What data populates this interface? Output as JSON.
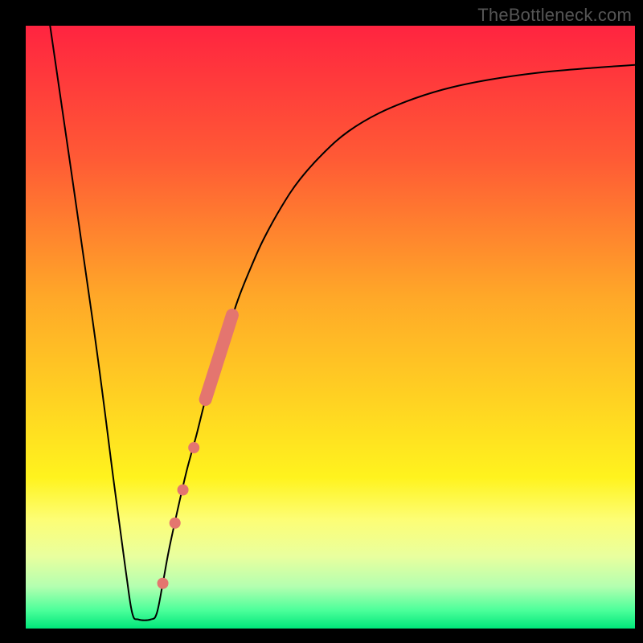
{
  "watermark": "TheBottleneck.com",
  "chart_data": {
    "type": "line",
    "title": "",
    "xlabel": "",
    "ylabel": "",
    "xlim": [
      0,
      100
    ],
    "ylim": [
      0,
      100
    ],
    "grid": false,
    "legend": false,
    "background_gradient": {
      "stops": [
        {
          "offset": 0.0,
          "color": "#ff2440"
        },
        {
          "offset": 0.22,
          "color": "#ff5a35"
        },
        {
          "offset": 0.45,
          "color": "#ffa828"
        },
        {
          "offset": 0.62,
          "color": "#ffd222"
        },
        {
          "offset": 0.75,
          "color": "#fff31e"
        },
        {
          "offset": 0.82,
          "color": "#fdfe76"
        },
        {
          "offset": 0.88,
          "color": "#e9ff9e"
        },
        {
          "offset": 0.93,
          "color": "#b4ffb0"
        },
        {
          "offset": 0.97,
          "color": "#4bff9a"
        },
        {
          "offset": 1.0,
          "color": "#00e77a"
        }
      ]
    },
    "series": [
      {
        "name": "bottleneck-curve",
        "color": "#000000",
        "stroke_width": 2,
        "points": [
          {
            "x": 4.0,
            "y": 100.0
          },
          {
            "x": 11.0,
            "y": 51.0
          },
          {
            "x": 14.5,
            "y": 24.0
          },
          {
            "x": 16.5,
            "y": 9.0
          },
          {
            "x": 17.5,
            "y": 2.5
          },
          {
            "x": 18.5,
            "y": 1.5
          },
          {
            "x": 20.5,
            "y": 1.5
          },
          {
            "x": 21.5,
            "y": 2.5
          },
          {
            "x": 22.5,
            "y": 7.5
          },
          {
            "x": 23.5,
            "y": 13.0
          },
          {
            "x": 25.0,
            "y": 20.0
          },
          {
            "x": 26.5,
            "y": 26.5
          },
          {
            "x": 28.0,
            "y": 32.0
          },
          {
            "x": 29.5,
            "y": 38.0
          },
          {
            "x": 31.0,
            "y": 43.0
          },
          {
            "x": 33.0,
            "y": 49.0
          },
          {
            "x": 35.0,
            "y": 55.0
          },
          {
            "x": 37.0,
            "y": 60.0
          },
          {
            "x": 39.0,
            "y": 64.5
          },
          {
            "x": 42.0,
            "y": 70.0
          },
          {
            "x": 45.0,
            "y": 74.5
          },
          {
            "x": 49.0,
            "y": 79.0
          },
          {
            "x": 53.0,
            "y": 82.5
          },
          {
            "x": 58.0,
            "y": 85.5
          },
          {
            "x": 64.0,
            "y": 88.0
          },
          {
            "x": 70.0,
            "y": 89.8
          },
          {
            "x": 77.0,
            "y": 91.2
          },
          {
            "x": 85.0,
            "y": 92.3
          },
          {
            "x": 93.0,
            "y": 93.0
          },
          {
            "x": 100.0,
            "y": 93.5
          }
        ]
      }
    ],
    "markers": {
      "band": {
        "color": "#e4756f",
        "width": 16,
        "start": {
          "x": 29.5,
          "y": 38.0
        },
        "end": {
          "x": 33.9,
          "y": 52.0
        }
      },
      "dots": [
        {
          "x": 22.5,
          "y": 7.5,
          "r": 7,
          "color": "#e4756f"
        },
        {
          "x": 24.5,
          "y": 17.5,
          "r": 7,
          "color": "#e4756f"
        },
        {
          "x": 25.8,
          "y": 23.0,
          "r": 7,
          "color": "#e4756f"
        },
        {
          "x": 27.6,
          "y": 30.0,
          "r": 7,
          "color": "#e4756f"
        }
      ]
    }
  }
}
